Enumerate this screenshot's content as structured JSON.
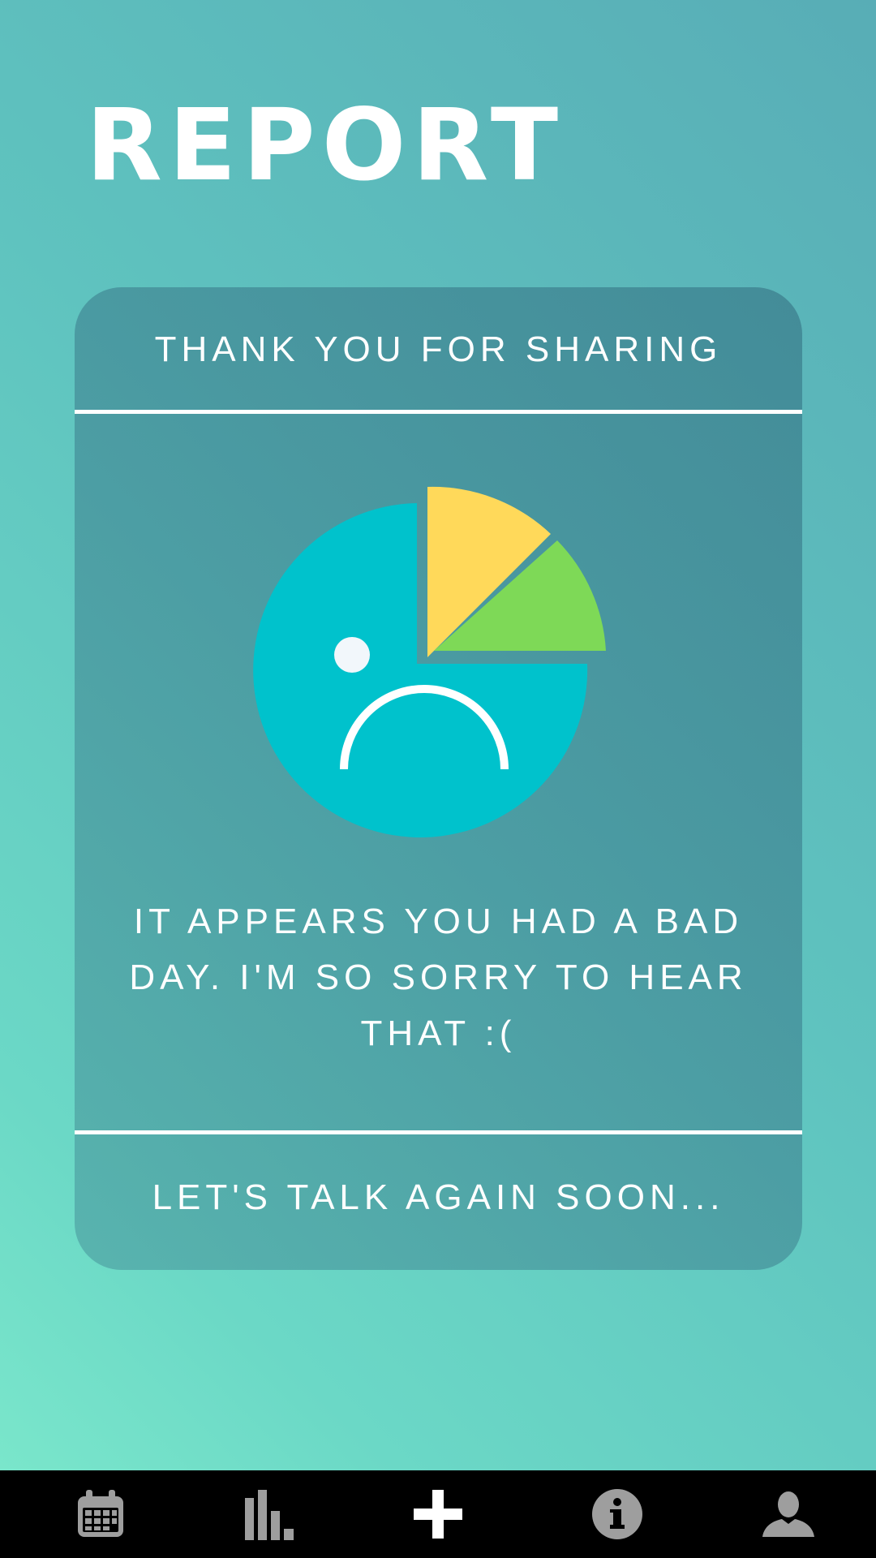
{
  "header": {
    "title": "REPORT"
  },
  "report_card": {
    "heading": "THANK YOU FOR SHARING",
    "message": "IT APPEARS YOU HAD A BAD DAY. I'M SO SORRY TO HEAR THAT :(",
    "closing": "LET'S TALK AGAIN SOON...",
    "illustration": {
      "icon": "sad-face-pie-chart",
      "colors": {
        "face": "#00c2cc",
        "slice_yellow": "#ffd95a",
        "slice_green": "#7ed957",
        "eye": "#f2f7fb",
        "mouth": "#ffffff"
      }
    }
  },
  "bottom_nav": {
    "items": [
      {
        "icon": "calendar-icon",
        "color": "#9e9e9e"
      },
      {
        "icon": "bar-chart-icon",
        "color": "#9e9e9e"
      },
      {
        "icon": "plus-icon",
        "color": "#ffffff",
        "active": true
      },
      {
        "icon": "info-icon",
        "color": "#9e9e9e"
      },
      {
        "icon": "profile-icon",
        "color": "#9e9e9e"
      }
    ]
  }
}
